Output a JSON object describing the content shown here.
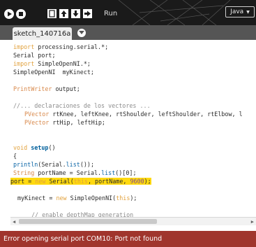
{
  "toolbar": {
    "run_label": "Run",
    "mode_label": "Java",
    "buttons": [
      "play-icon",
      "stop-icon",
      "new-icon",
      "open-icon",
      "save-icon",
      "export-icon"
    ]
  },
  "tab": {
    "name": "sketch_140716a"
  },
  "code": {
    "l1_kw": "import",
    "l1_rest": " processing.serial.*;",
    "l2": "Serial port;",
    "l3_kw": "import",
    "l3_rest": " SimpleOpenNI.*;",
    "l4": "SimpleOpenNI  myKinect;",
    "l6_type": "PrintWriter",
    "l6_rest": " output;",
    "l8": "//... declaraciones de los vectores ...",
    "l9_type": "PVector",
    "l9_rest": " rtKnee, leftKnee, rtShoulder, leftShoulder, rtElbow, l",
    "l10_type": "PVector",
    "l10_rest": " rtHip, leftHip;",
    "l13_kw": "void",
    "l13_fn": "setup",
    "l13_rest": "()",
    "l14": "{",
    "l15_fn": "println",
    "l15_mid": "(Serial.",
    "l15_fn2": "list",
    "l15_rest": "());",
    "l16_type": "String",
    "l16_mid": " portName = Serial.",
    "l16_fn": "list",
    "l16_rest": "()[0];",
    "l17_a": "port = ",
    "l17_kw": "new",
    "l17_b": " Serial(",
    "l17_this": "this",
    "l17_c": ", portName, ",
    "l17_num": "9600",
    "l17_d": ");",
    "l19_a": "myKinect = ",
    "l19_kw": "new",
    "l19_b": " SimpleOpenNI(",
    "l19_this": "this",
    "l19_c": ");",
    "l21": "// enable depthMap generation"
  },
  "status": {
    "message": "Error opening serial port COM10: Port not found"
  },
  "colors": {
    "toolbar": "#1a1a1a",
    "tabbar": "#555555",
    "status": "#a0352d",
    "highlight": "#ffd90f"
  }
}
